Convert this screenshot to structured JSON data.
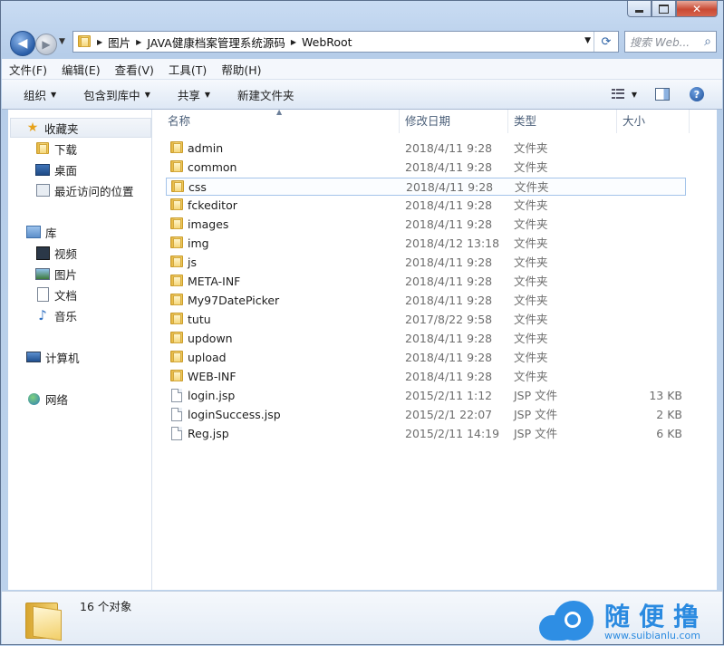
{
  "window": {
    "minimize_icon": "minimize-icon",
    "maximize_icon": "maximize-icon",
    "close_icon": "close-icon",
    "close_glyph": "✕"
  },
  "nav": {
    "back_glyph": "◀",
    "forward_glyph": "▶",
    "dropdown_glyph": "▼"
  },
  "address": {
    "crumbs": [
      "图片",
      "JAVA健康档案管理系统源码",
      "WebRoot"
    ],
    "separator": "▶",
    "dropdown_glyph": "▼",
    "refresh_glyph": "⟳"
  },
  "search": {
    "placeholder": "搜索 Web...",
    "icon": "search-icon",
    "glyph": "⌕"
  },
  "menubar": {
    "items": [
      "文件(F)",
      "编辑(E)",
      "查看(V)",
      "工具(T)",
      "帮助(H)"
    ]
  },
  "toolbar": {
    "organize": "组织",
    "include_library": "包含到库中",
    "share": "共享",
    "new_folder": "新建文件夹",
    "arrow": "▼",
    "help_glyph": "?"
  },
  "navpane": {
    "favorites": "收藏夹",
    "downloads": "下载",
    "desktop": "桌面",
    "recent": "最近访问的位置",
    "libraries": "库",
    "videos": "视频",
    "pictures": "图片",
    "documents": "文档",
    "music": "音乐",
    "computer": "计算机",
    "network": "网络"
  },
  "columns": {
    "name": "名称",
    "date": "修改日期",
    "type": "类型",
    "size": "大小",
    "sort_glyph": "▲"
  },
  "files": [
    {
      "name": "admin",
      "date": "2018/4/11 9:28",
      "type": "文件夹",
      "size": "",
      "kind": "folder"
    },
    {
      "name": "common",
      "date": "2018/4/11 9:28",
      "type": "文件夹",
      "size": "",
      "kind": "folder"
    },
    {
      "name": "css",
      "date": "2018/4/11 9:28",
      "type": "文件夹",
      "size": "",
      "kind": "folder"
    },
    {
      "name": "fckeditor",
      "date": "2018/4/11 9:28",
      "type": "文件夹",
      "size": "",
      "kind": "folder"
    },
    {
      "name": "images",
      "date": "2018/4/11 9:28",
      "type": "文件夹",
      "size": "",
      "kind": "folder"
    },
    {
      "name": "img",
      "date": "2018/4/12 13:18",
      "type": "文件夹",
      "size": "",
      "kind": "folder"
    },
    {
      "name": "js",
      "date": "2018/4/11 9:28",
      "type": "文件夹",
      "size": "",
      "kind": "folder"
    },
    {
      "name": "META-INF",
      "date": "2018/4/11 9:28",
      "type": "文件夹",
      "size": "",
      "kind": "folder"
    },
    {
      "name": "My97DatePicker",
      "date": "2018/4/11 9:28",
      "type": "文件夹",
      "size": "",
      "kind": "folder"
    },
    {
      "name": "tutu",
      "date": "2017/8/22 9:58",
      "type": "文件夹",
      "size": "",
      "kind": "folder"
    },
    {
      "name": "updown",
      "date": "2018/4/11 9:28",
      "type": "文件夹",
      "size": "",
      "kind": "folder"
    },
    {
      "name": "upload",
      "date": "2018/4/11 9:28",
      "type": "文件夹",
      "size": "",
      "kind": "folder"
    },
    {
      "name": "WEB-INF",
      "date": "2018/4/11 9:28",
      "type": "文件夹",
      "size": "",
      "kind": "folder"
    },
    {
      "name": "login.jsp",
      "date": "2015/2/11 1:12",
      "type": "JSP 文件",
      "size": "13 KB",
      "kind": "file"
    },
    {
      "name": "loginSuccess.jsp",
      "date": "2015/2/1 22:07",
      "type": "JSP 文件",
      "size": "2 KB",
      "kind": "file"
    },
    {
      "name": "Reg.jsp",
      "date": "2015/2/11 14:19",
      "type": "JSP 文件",
      "size": "6 KB",
      "kind": "file"
    }
  ],
  "focused_row": "css",
  "status": {
    "count_text": "16 个对象"
  },
  "watermark": {
    "title": "随便撸",
    "url": "www.suibianlu.com",
    "color": "#2a8ae0"
  },
  "colors": {
    "folder": "#f2cf68",
    "selection_border": "#a4c4ea",
    "header_text": "#4c607a"
  }
}
